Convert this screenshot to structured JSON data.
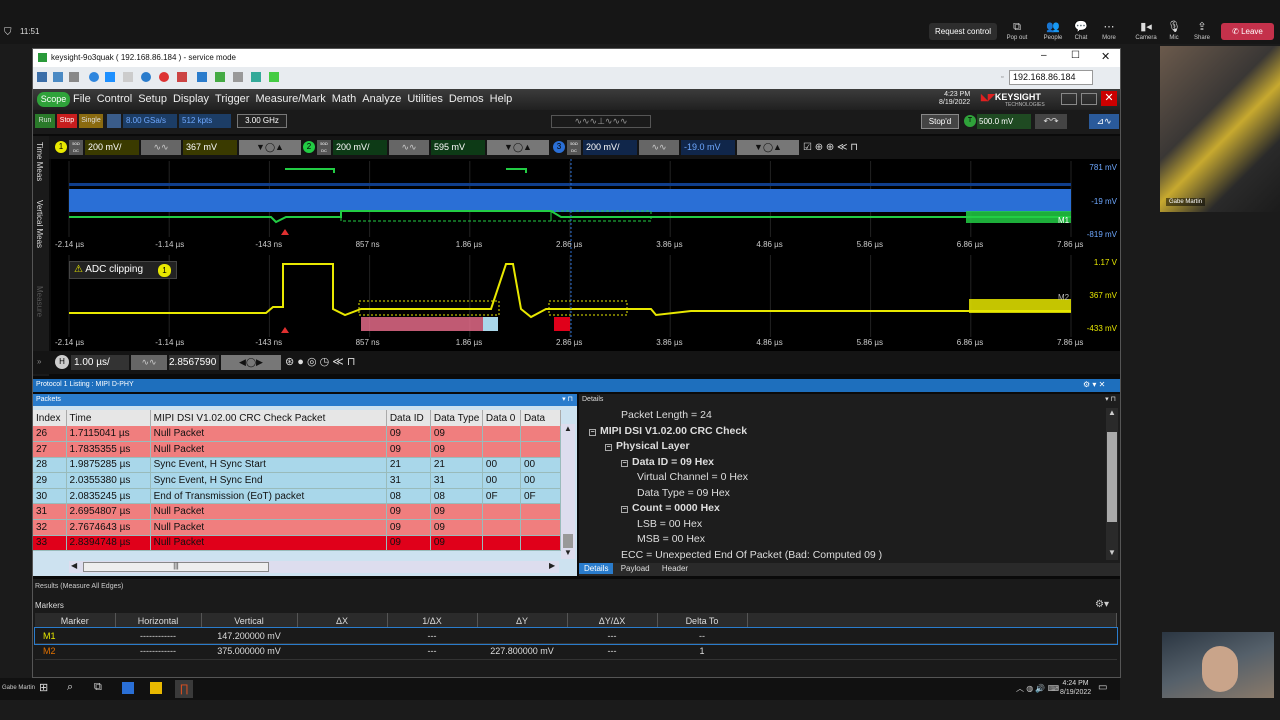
{
  "teams": {
    "time": "11:51",
    "request_control": "Request control",
    "popout": "Pop out",
    "people": "People",
    "chat": "Chat",
    "more": "More",
    "camera": "Camera",
    "mic": "Mic",
    "share": "Share",
    "leave": "Leave",
    "presenter": "Gabe Martin"
  },
  "window": {
    "title": "keysight-9o3quak ( 192.168.86.184 ) - service mode",
    "ip": "192.168.86.184",
    "clock_time": "4:23 PM",
    "clock_date": "8/19/2022",
    "brand": "KEYSIGHT",
    "brand_sub": "TECHNOLOGIES"
  },
  "menu": {
    "scope": "Scope",
    "items": [
      "File",
      "Control",
      "Setup",
      "Display",
      "Trigger",
      "Measure/Mark",
      "Math",
      "Analyze",
      "Utilities",
      "Demos",
      "Help"
    ]
  },
  "control": {
    "run": "Run",
    "stop": "Stop",
    "single": "Single",
    "sample_rate": "8.00 GSa/s",
    "points": "512 kpts",
    "bandwidth": "3.00 GHz",
    "stopd": "Stop'd",
    "trigger_level": "500.0 mV"
  },
  "channels": {
    "ch1_num": "1",
    "ch1_scale": "200 mV/",
    "ch1_offset": "367 mV",
    "ch1_imp": "50Ω DC",
    "ch2_num": "2",
    "ch2_scale": "200 mV/",
    "ch2_offset": "595 mV",
    "ch2_imp": "50Ω DC",
    "ch3_num": "3",
    "ch3_scale": "200 mV/",
    "ch3_offset": "-19.0 mV",
    "ch3_imp": "50Ω DC"
  },
  "side_tabs": {
    "time": "Time",
    "meas": "Meas",
    "vertical": "Vertical",
    "vmeas": "Meas",
    "measure": "Measure"
  },
  "grid": {
    "time_ticks": [
      "-2.14 µs",
      "-1.14 µs",
      "-143 ns",
      "857 ns",
      "1.86 µs",
      "2.86 µs",
      "3.86 µs",
      "4.86 µs",
      "5.86 µs",
      "6.86 µs",
      "7.86 µs"
    ],
    "top_volts": [
      "781 mV",
      "-19 mV",
      "-819 mV"
    ],
    "bot_volts": [
      "1.17 V",
      "367 mV",
      "-433 mV"
    ],
    "m1": "M1",
    "m2": "M2",
    "adc": "ADC clipping",
    "adc_badge": "1"
  },
  "horizontal": {
    "h": "H",
    "scale": "1.00 µs/",
    "position": "2.8567590"
  },
  "protocol": {
    "title": "Protocol 1 Listing : MIPI D-PHY",
    "packets_title": "Packets",
    "details_title": "Details"
  },
  "packets": {
    "headers": [
      "Index",
      "Time",
      "MIPI DSI V1.02.00 CRC Check Packet",
      "Data ID",
      "Data Type",
      "Data 0",
      "Data"
    ],
    "rows": [
      {
        "cells": [
          "26",
          "1.7115041 µs",
          "Null Packet",
          "09",
          "09",
          "",
          ""
        ],
        "kind": "null"
      },
      {
        "cells": [
          "27",
          "1.7835355 µs",
          "Null Packet",
          "09",
          "09",
          "",
          ""
        ],
        "kind": "null"
      },
      {
        "cells": [
          "28",
          "1.9875285 µs",
          "Sync Event, H Sync Start",
          "21",
          "21",
          "00",
          "00"
        ],
        "kind": "sync"
      },
      {
        "cells": [
          "29",
          "2.0355380 µs",
          "Sync Event, H Sync End",
          "31",
          "31",
          "00",
          "00"
        ],
        "kind": "sync"
      },
      {
        "cells": [
          "30",
          "2.0835245 µs",
          "End of Transmission (EoT) packet",
          "08",
          "08",
          "0F",
          "0F"
        ],
        "kind": "sync"
      },
      {
        "cells": [
          "31",
          "2.6954807 µs",
          "Null Packet",
          "09",
          "09",
          "",
          ""
        ],
        "kind": "null"
      },
      {
        "cells": [
          "32",
          "2.7674643 µs",
          "Null Packet",
          "09",
          "09",
          "",
          ""
        ],
        "kind": "null"
      },
      {
        "cells": [
          "33",
          "2.8394748 µs",
          "Null Packet",
          "09",
          "09",
          "",
          ""
        ],
        "kind": "sel"
      }
    ]
  },
  "details": {
    "lines": [
      {
        "text": "Packet Length = 24",
        "indent": 2,
        "bold": false,
        "minus": false
      },
      {
        "text": "MIPI DSI V1.02.00 CRC Check",
        "indent": 0,
        "bold": true,
        "minus": true
      },
      {
        "text": "Physical Layer",
        "indent": 1,
        "bold": true,
        "minus": true
      },
      {
        "text": "Data ID = 09 Hex",
        "indent": 2,
        "bold": true,
        "minus": true
      },
      {
        "text": "Virtual Channel = 0 Hex",
        "indent": 3,
        "bold": false,
        "minus": false
      },
      {
        "text": "Data Type = 09 Hex",
        "indent": 3,
        "bold": false,
        "minus": false
      },
      {
        "text": "Count = 0000 Hex",
        "indent": 2,
        "bold": true,
        "minus": true
      },
      {
        "text": "LSB = 00 Hex",
        "indent": 3,
        "bold": false,
        "minus": false
      },
      {
        "text": "MSB = 00 Hex",
        "indent": 3,
        "bold": false,
        "minus": false
      },
      {
        "text": "ECC = Unexpected End Of Packet (Bad: Computed 09 )",
        "indent": 2,
        "bold": false,
        "minus": false
      }
    ],
    "tabs": [
      "Details",
      "Payload",
      "Header"
    ]
  },
  "results": {
    "title": "Results  (Measure All Edges)",
    "markers_title": "Markers",
    "headers": [
      "Marker",
      "Horizontal",
      "Vertical",
      "ΔX",
      "1/ΔX",
      "ΔY",
      "ΔY/ΔX",
      "Delta To"
    ],
    "rows": [
      [
        "M1",
        "------------",
        "147.200000 mV",
        "",
        "---",
        "",
        "---",
        "--"
      ],
      [
        "M2",
        "------------",
        "375.000000 mV",
        "",
        "---",
        "227.800000 mV",
        "---",
        "1"
      ]
    ]
  },
  "taskbar": {
    "user": "Gabe Martin",
    "time": "4:24 PM",
    "date": "8/19/2022"
  },
  "colors": {
    "ch1": "#e8e800",
    "ch2": "#22cc44",
    "ch3": "#2a6fd6",
    "null_row": "#f07e7e",
    "sync_row": "#a9d7ea",
    "sel_row": "#e0001a"
  }
}
